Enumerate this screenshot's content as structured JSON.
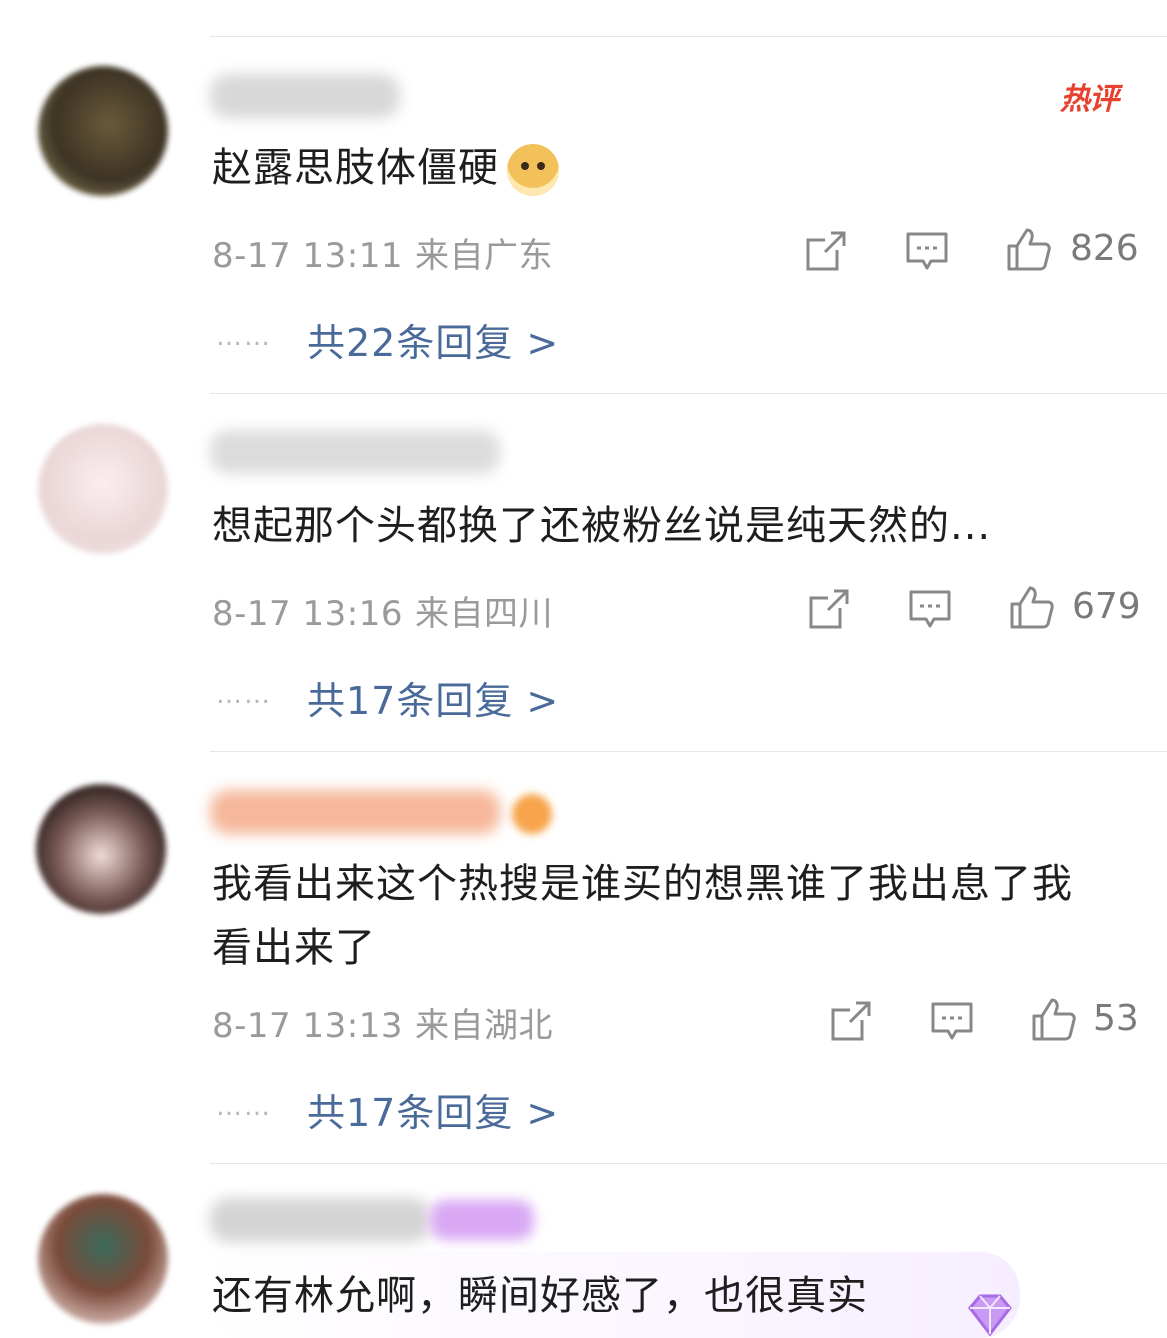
{
  "comments": [
    {
      "text": "赵露思肢体僵硬",
      "emoji": "doge-emoji",
      "hot_label": "热评",
      "time": "8-17 13:11",
      "location": "来自广东",
      "likes": "826",
      "replies": "共22条回复 >",
      "dots": "……"
    },
    {
      "text": "想起那个头都换了还被粉丝说是纯天然的...",
      "time": "8-17 13:16",
      "location": "来自四川",
      "likes": "679",
      "replies": "共17条回复 >",
      "dots": "……"
    },
    {
      "text": "我看出来这个热搜是谁买的想黑谁了我出息了我看出来了",
      "time": "8-17 13:13",
      "location": "来自湖北",
      "likes": "53",
      "replies": "共17条回复 >",
      "dots": "……"
    },
    {
      "text": "还有林允啊，瞬间好感了，也很真实"
    }
  ],
  "icons": {
    "share": "share-icon",
    "comment": "comment-icon",
    "like": "thumbs-up-icon",
    "badge": "gem-badge-icon"
  },
  "colors": {
    "reply_link": "#4a6a9a",
    "meta": "#9a9a9a",
    "hot": "#e8422e"
  }
}
